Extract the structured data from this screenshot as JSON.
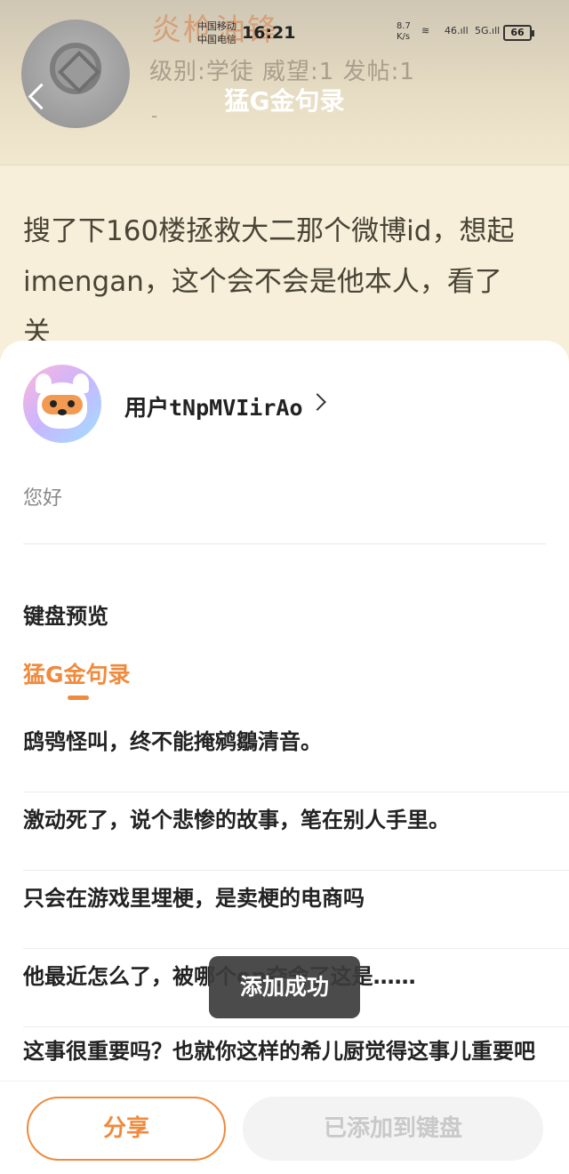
{
  "status_bar": {
    "carrier1": "中国移动",
    "carrier2": "中国电信",
    "time": "16:21",
    "net_speed_value": "8.7",
    "net_speed_unit": "K/s",
    "signal1": "46",
    "signal2": "5G",
    "battery": "66"
  },
  "background_page": {
    "title": "猛G金句录",
    "user_name": "炎枪油锋",
    "user_stats": "级别:学徒 威望:1 发帖:1",
    "dash": "-",
    "post_lines": [
      "搜了下160楼拯救大二那个微博id，想起",
      "imengan，这个会不会是他本人，看了",
      "关"
    ]
  },
  "sheet": {
    "user_name": "用户tNpMVIirAo",
    "greeting": "您好",
    "section_title": "键盘预览",
    "active_tab": "猛G金句录",
    "phrases": [
      "鸱鸮怪叫，终不能掩鹓鶵清音。",
      "激动死了，说个悲惨的故事，笔在别人手里。",
      "只会在游戏里埋梗，是卖梗的电商吗",
      "他最近怎么了，被哪个op夺舍了这是……",
      "这事很重要吗？也就你这样的希儿厨觉得这事儿重要吧"
    ]
  },
  "footer": {
    "share_label": "分享",
    "added_label": "已添加到键盘"
  },
  "toast": {
    "message": "添加成功"
  }
}
